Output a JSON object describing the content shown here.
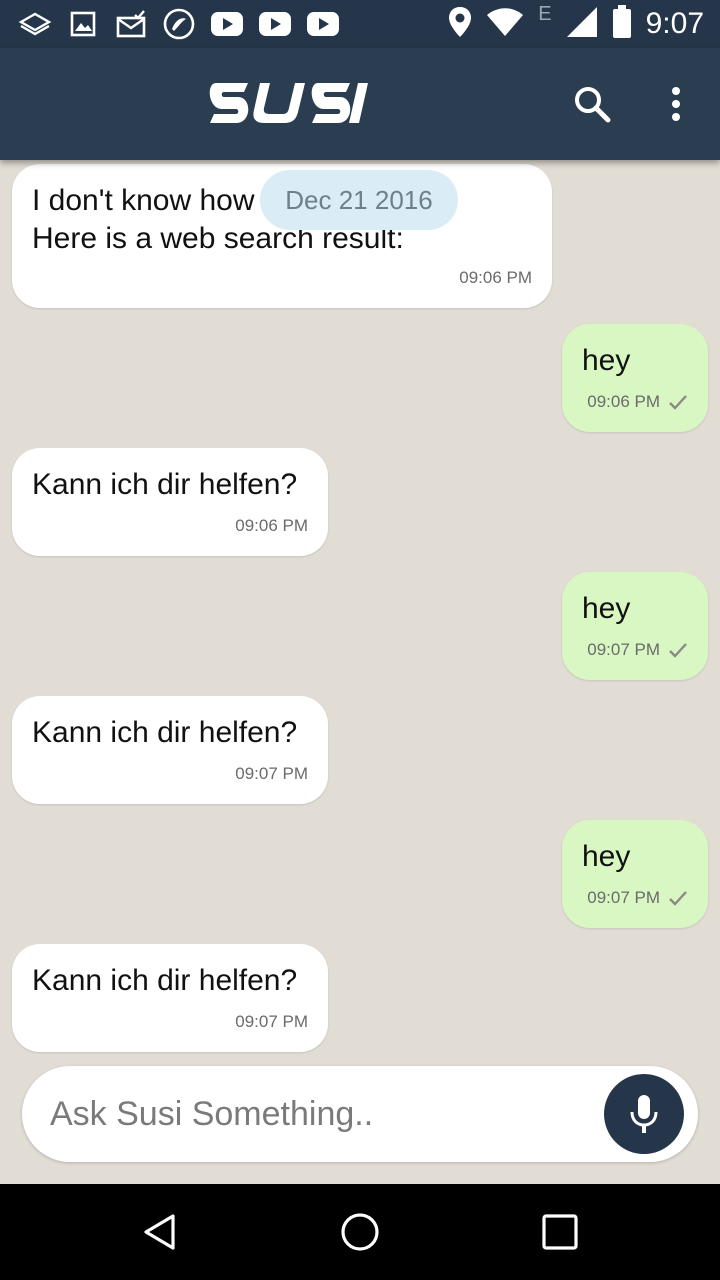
{
  "status_bar": {
    "time": "9:07",
    "network_label": "E",
    "icons": [
      "layers-icon",
      "image-icon",
      "mail-check-icon",
      "swirl-app-icon",
      "youtube-icon",
      "youtube-icon",
      "youtube-icon",
      "location-icon",
      "wifi-icon",
      "signal-icon",
      "battery-icon"
    ]
  },
  "app_bar": {
    "logo_text": "SUSI",
    "icons": [
      "search-icon",
      "more-vert-icon"
    ]
  },
  "chat": {
    "date_label": "Dec 21 2016",
    "messages": [
      {
        "from": "susi",
        "text": "I don't know how to answer this.\nHere is a web search result:",
        "time": "09:06 PM"
      },
      {
        "from": "user",
        "text": "hey",
        "time": "09:06 PM"
      },
      {
        "from": "susi",
        "text": "Kann ich dir helfen?",
        "time": "09:06 PM"
      },
      {
        "from": "user",
        "text": "hey",
        "time": "09:07 PM"
      },
      {
        "from": "susi",
        "text": "Kann ich dir helfen?",
        "time": "09:07 PM"
      },
      {
        "from": "user",
        "text": "hey",
        "time": "09:07 PM"
      },
      {
        "from": "susi",
        "text": "Kann ich dir helfen?",
        "time": "09:07 PM"
      }
    ]
  },
  "composer": {
    "placeholder": "Ask Susi Something..",
    "value": ""
  },
  "colors": {
    "app_bar": "#2b3e51",
    "status_bar": "#25364a",
    "chat_background": "#e2ddd4",
    "user_bubble": "#d9f7c2",
    "susi_bubble": "#ffffff",
    "date_pill": "#daecf6"
  }
}
